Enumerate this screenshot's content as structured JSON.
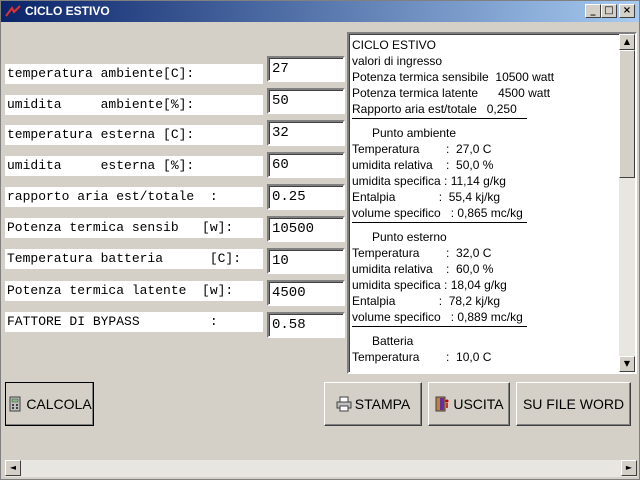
{
  "window": {
    "title": "CICLO ESTIVO",
    "min": "_",
    "max": "□",
    "close": "×"
  },
  "inputs": [
    {
      "label": "temperatura ambiente[C]:",
      "value": "27"
    },
    {
      "label": "umidita     ambiente[%]:",
      "value": "50"
    },
    {
      "label": "temperatura esterna [C]:",
      "value": "32"
    },
    {
      "label": "umidita     esterna [%]:",
      "value": "60"
    },
    {
      "label": "rapporto aria est/totale  :",
      "value": "0.25"
    },
    {
      "label": "Potenza termica sensib   [w]:",
      "value": "10500"
    },
    {
      "label": "Temperatura batteria      [C]:",
      "value": "10"
    },
    {
      "label": "Potenza termica latente  [w]:",
      "value": "4500"
    },
    {
      "label": "FATTORE DI BYPASS         :",
      "value": "0.58"
    }
  ],
  "output": {
    "lines": [
      "CICLO ESTIVO",
      "valori di ingresso",
      "Potenza termica sensibile  10500 watt",
      "Potenza termica latente      4500 watt",
      "Rapporto aria est/totale   0,250",
      "",
      "      Punto ambiente",
      "Temperatura        :  27,0 C",
      "umidita relativa    :  50,0 %",
      "umidita specifica : 11,14 g/kg",
      "Entalpia             :  55,4 kj/kg",
      "volume specifico   : 0,865 mc/kg",
      "",
      "      Punto esterno",
      "Temperatura        :  32,0 C",
      "umidita relativa    :  60,0 %",
      "umidita specifica : 18,04 g/kg",
      "Entalpia             :  78,2 kj/kg",
      "volume specifico   : 0,889 mc/kg",
      "",
      "      Batteria",
      "Temperatura        :  10,0 C"
    ],
    "scroll_up": "▲",
    "scroll_down": "▼"
  },
  "buttons": {
    "calcola": "CALCOLA",
    "stampa": "STAMPA",
    "uscita": "USCITA",
    "word": "SU FILE WORD"
  },
  "hscroll": {
    "left": "◄",
    "right": "►"
  }
}
